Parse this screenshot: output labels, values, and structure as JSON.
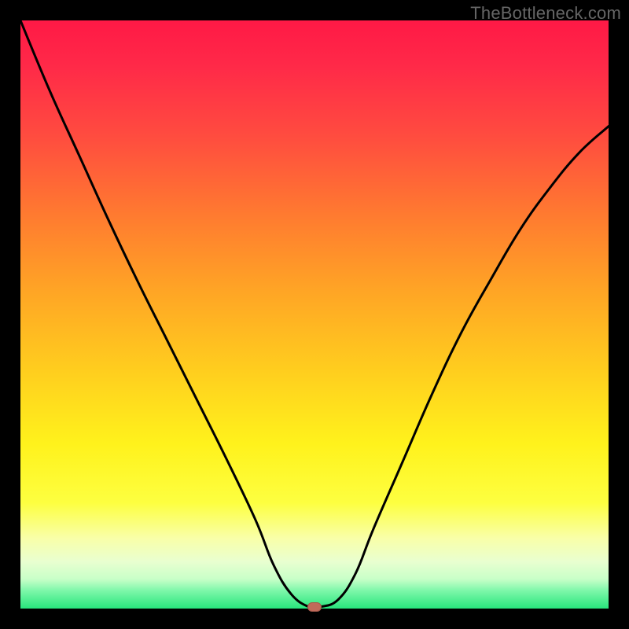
{
  "watermark": "TheBottleneck.com",
  "chart_data": {
    "type": "line",
    "title": "",
    "xlabel": "",
    "ylabel": "",
    "xlim": [
      0,
      1
    ],
    "ylim": [
      0,
      1
    ],
    "series": [
      {
        "name": "curve",
        "x": [
          0.0,
          0.05,
          0.1,
          0.15,
          0.2,
          0.25,
          0.3,
          0.35,
          0.4,
          0.43,
          0.46,
          0.49,
          0.51,
          0.54,
          0.57,
          0.6,
          0.65,
          0.7,
          0.75,
          0.8,
          0.85,
          0.9,
          0.95,
          1.0
        ],
        "y": [
          1.0,
          0.88,
          0.77,
          0.66,
          0.555,
          0.455,
          0.355,
          0.255,
          0.15,
          0.075,
          0.025,
          0.003,
          0.003,
          0.015,
          0.06,
          0.135,
          0.25,
          0.365,
          0.47,
          0.56,
          0.645,
          0.715,
          0.775,
          0.82
        ]
      }
    ],
    "marker": {
      "x": 0.5,
      "y": 0.0
    },
    "gradient_stops": [
      {
        "pos": 0.0,
        "color": "#ff1946"
      },
      {
        "pos": 0.6,
        "color": "#ffcf1e"
      },
      {
        "pos": 0.88,
        "color": "#f9ffa8"
      },
      {
        "pos": 1.0,
        "color": "#28e57c"
      }
    ]
  }
}
